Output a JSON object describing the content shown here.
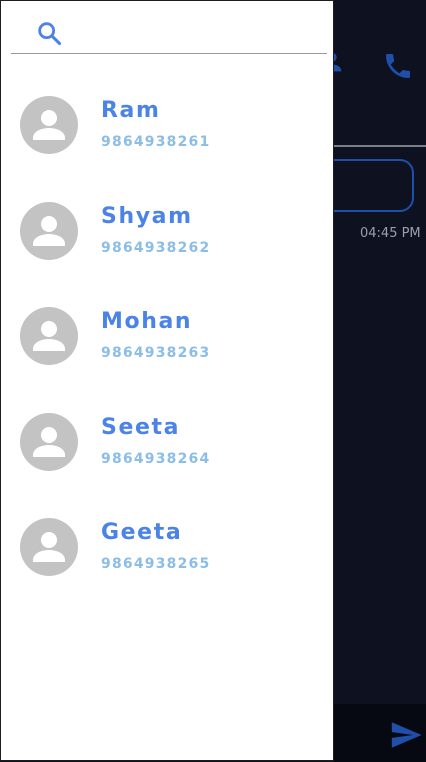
{
  "search": {
    "placeholder": ""
  },
  "contacts": [
    {
      "name": "Ram",
      "phone": "9864938261"
    },
    {
      "name": "Shyam",
      "phone": "9864938262"
    },
    {
      "name": "Mohan",
      "phone": "9864938263"
    },
    {
      "name": "Seeta",
      "phone": "9864938264"
    },
    {
      "name": "Geeta",
      "phone": "9864938265"
    }
  ],
  "chat": {
    "message_time": "04:45 PM"
  },
  "icons": {
    "search": "search-icon",
    "avatar": "person-avatar-icon",
    "call": "phone-icon",
    "profile": "person-icon",
    "send": "send-icon"
  },
  "colors": {
    "accent": "#4b83e6",
    "phone_text": "#8bbde7",
    "chat_background": "#0d1120"
  }
}
